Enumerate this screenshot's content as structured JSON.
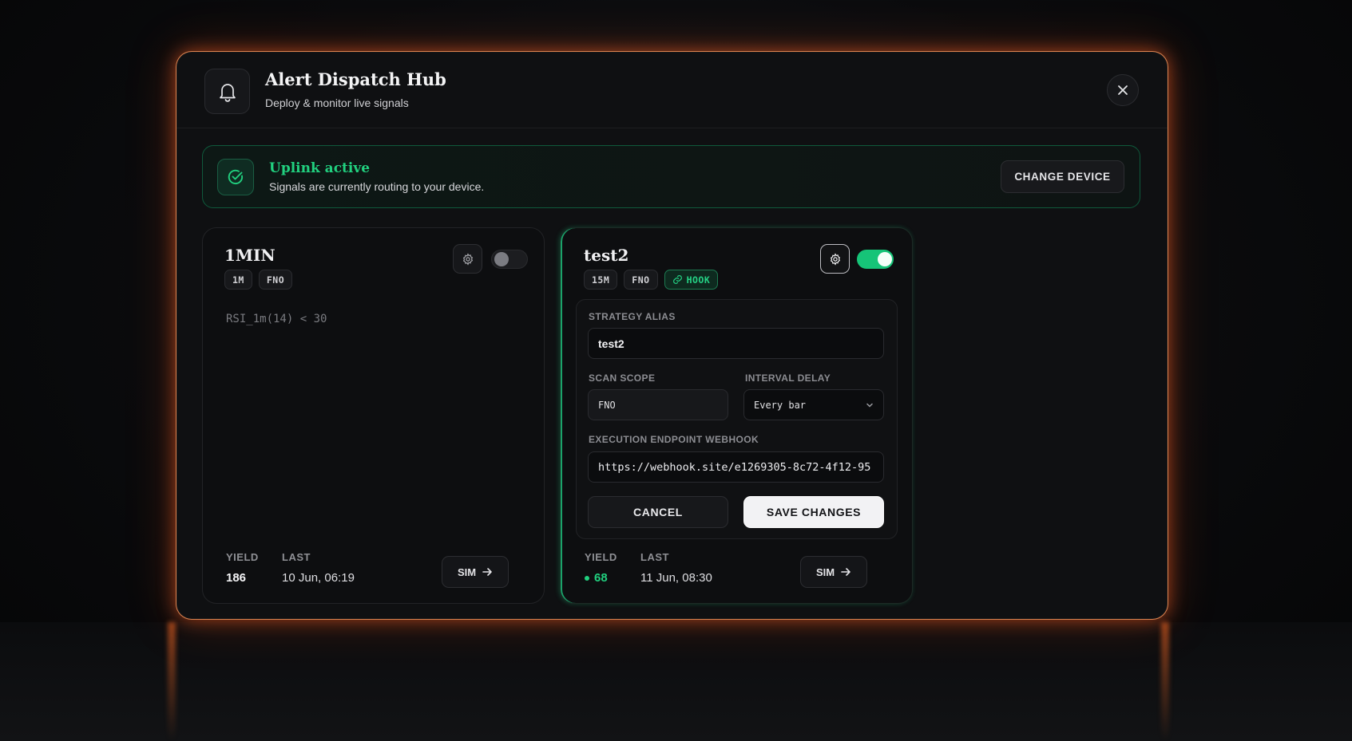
{
  "header": {
    "title": "Alert Dispatch Hub",
    "subtitle": "Deploy & monitor live signals"
  },
  "status": {
    "title": "Uplink active",
    "message": "Signals are currently routing to your device.",
    "change_device_label": "CHANGE DEVICE",
    "accent": "#21d07f"
  },
  "strategies": [
    {
      "name": "1MIN",
      "tags": [
        "1M",
        "FNO"
      ],
      "enabled": false,
      "expression": "RSI_1m(14) < 30",
      "yield_label": "YIELD",
      "yield": "186",
      "last_label": "LAST",
      "last": "10 Jun, 06:19",
      "sim_label": "SIM"
    },
    {
      "name": "test2",
      "tags": [
        "15M",
        "FNO"
      ],
      "hook_tag": "HOOK",
      "enabled": true,
      "yield_label": "YIELD",
      "yield": "68",
      "last_label": "LAST",
      "last": "11 Jun, 08:30",
      "sim_label": "SIM",
      "form": {
        "alias_label": "STRATEGY ALIAS",
        "alias_value": "test2",
        "scope_label": "SCAN SCOPE",
        "scope_value": "FNO",
        "interval_label": "INTERVAL DELAY",
        "interval_value": "Every bar",
        "webhook_label": "EXECUTION ENDPOINT WEBHOOK",
        "webhook_value": "https://webhook.site/e1269305-8c72-4f12-95",
        "cancel_label": "CANCEL",
        "save_label": "SAVE CHANGES"
      }
    }
  ],
  "icons": {
    "bell": "bell-icon",
    "close": "close-icon",
    "check": "check-circle-icon",
    "gear": "gear-icon",
    "link": "link-icon",
    "arrow": "arrow-right-icon",
    "chevron": "chevron-down-icon"
  },
  "colors": {
    "frame_glow": "#ff7a3a",
    "green": "#16c478",
    "save_bg": "#f2f2f4"
  }
}
